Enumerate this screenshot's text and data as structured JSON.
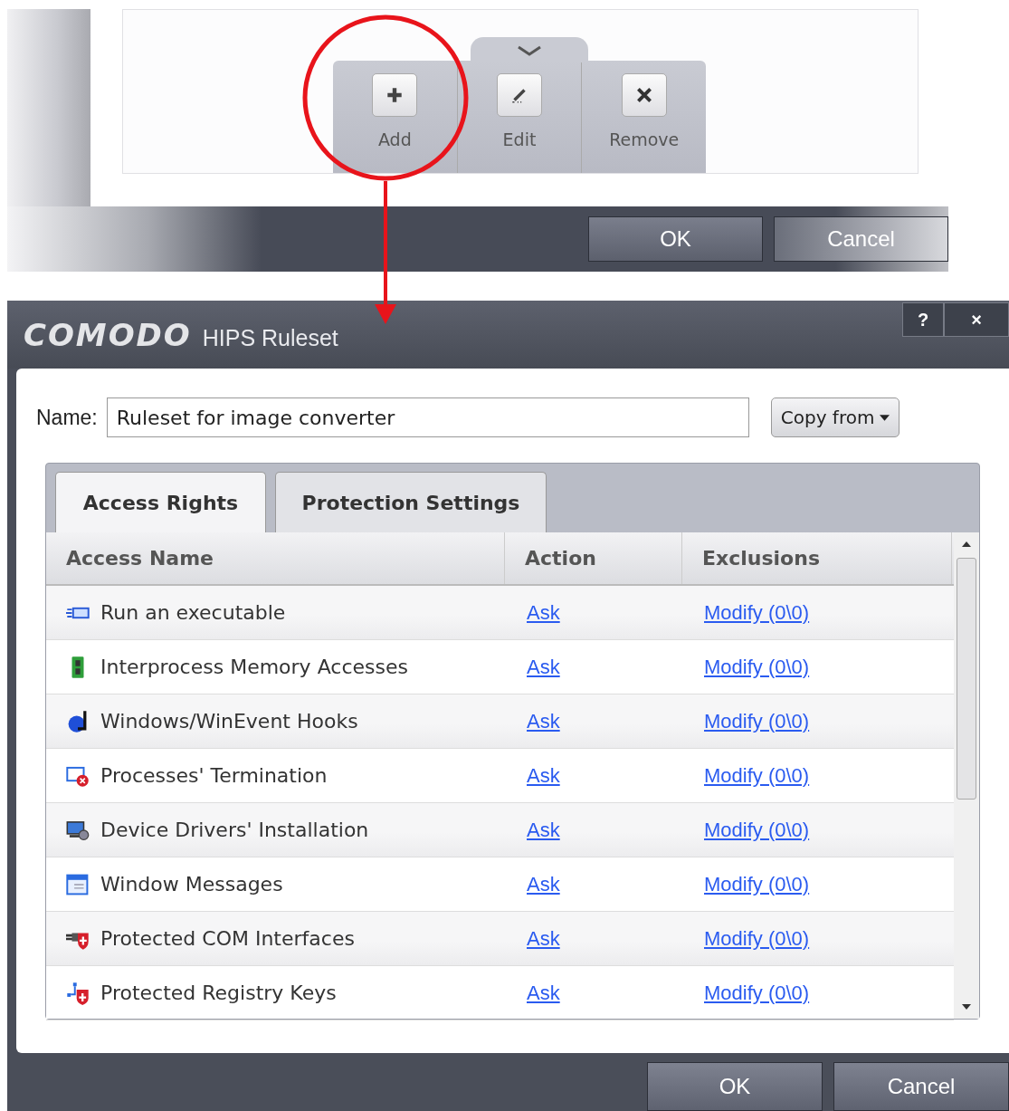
{
  "background_window": {
    "toolbar": [
      {
        "label": "Add",
        "kind": "add"
      },
      {
        "label": "Edit",
        "kind": "edit"
      },
      {
        "label": "Remove",
        "kind": "remove"
      }
    ],
    "buttons": [
      "OK",
      "Cancel"
    ]
  },
  "dialog": {
    "brand": "COMODO",
    "title": "HIPS Ruleset",
    "title_buttons": [
      "?",
      "×"
    ],
    "name_label": "Name:",
    "name_value": "Ruleset for image converter",
    "copy_button": "Copy from",
    "tabs": [
      {
        "label": "Access Rights",
        "selected": true
      },
      {
        "label": "Protection Settings",
        "selected": false
      }
    ],
    "columns": [
      "Access Name",
      "Action",
      "Exclusions"
    ],
    "rows": [
      {
        "name": "Run an executable",
        "kind": "run",
        "action": "Ask",
        "exclusions": "Modify (0\\0)"
      },
      {
        "name": "Interprocess Memory Accesses",
        "kind": "memory",
        "action": "Ask",
        "exclusions": "Modify (0\\0)"
      },
      {
        "name": "Windows/WinEvent Hooks",
        "kind": "hook",
        "action": "Ask",
        "exclusions": "Modify (0\\0)"
      },
      {
        "name": "Processes' Termination",
        "kind": "terminate",
        "action": "Ask",
        "exclusions": "Modify (0\\0)"
      },
      {
        "name": "Device Drivers' Installation",
        "kind": "driver",
        "action": "Ask",
        "exclusions": "Modify (0\\0)"
      },
      {
        "name": "Window Messages",
        "kind": "message",
        "action": "Ask",
        "exclusions": "Modify (0\\0)"
      },
      {
        "name": "Protected COM Interfaces",
        "kind": "com",
        "action": "Ask",
        "exclusions": "Modify (0\\0)"
      },
      {
        "name": "Protected Registry Keys",
        "kind": "registry",
        "action": "Ask",
        "exclusions": "Modify (0\\0)"
      }
    ],
    "buttons": [
      "OK",
      "Cancel"
    ]
  }
}
